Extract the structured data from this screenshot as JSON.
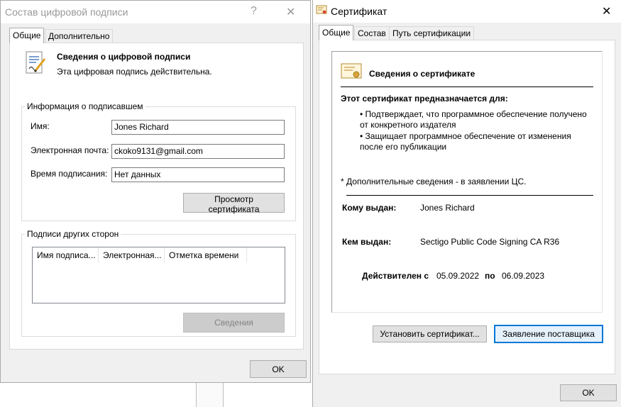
{
  "sig_window": {
    "title": "Состав цифровой подписи",
    "help_glyph": "?",
    "close_glyph": "✕",
    "tabs": [
      "Общие",
      "Дополнительно"
    ],
    "heading": "Сведения о цифровой подписи",
    "status": "Эта цифровая подпись действительна.",
    "signer_group_title": "Информация о подписавшем",
    "name_label": "Имя:",
    "name_value": "Jones Richard",
    "email_label": "Электронная почта:",
    "email_value": "ckoko9131@gmail.com",
    "time_label": "Время подписания:",
    "time_value": "Нет данных",
    "view_cert_button": "Просмотр сертификата",
    "countersig_group_title": "Подписи других сторон",
    "columns": [
      "Имя подписа...",
      "Электронная...",
      "Отметка времени"
    ],
    "details_button": "Сведения",
    "ok_button": "OK"
  },
  "cert_window": {
    "title": "Сертификат",
    "close_glyph": "✕",
    "tabs": [
      "Общие",
      "Состав",
      "Путь сертификации"
    ],
    "heading": "Сведения о сертификате",
    "purpose_title": "Этот сертификат предназначается для:",
    "bullets": [
      "• Подтверждает, что программное обеспечение получено",
      "от конкретного издателя",
      "• Защищает программное обеспечение от  изменения",
      "после его публикации"
    ],
    "footnote": "* Дополнительные сведения - в заявлении ЦС.",
    "issued_to_label": "Кому выдан:",
    "issued_to_value": "Jones Richard",
    "issued_by_label": "Кем выдан:",
    "issued_by_value": "Sectigo Public Code Signing CA R36",
    "valid_from_label": "Действителен с",
    "valid_from_value": "05.09.2022",
    "valid_to_label": "по",
    "valid_to_value": "06.09.2023",
    "install_button": "Установить сертификат...",
    "statement_button": "Заявление поставщика",
    "ok_button": "OK"
  }
}
